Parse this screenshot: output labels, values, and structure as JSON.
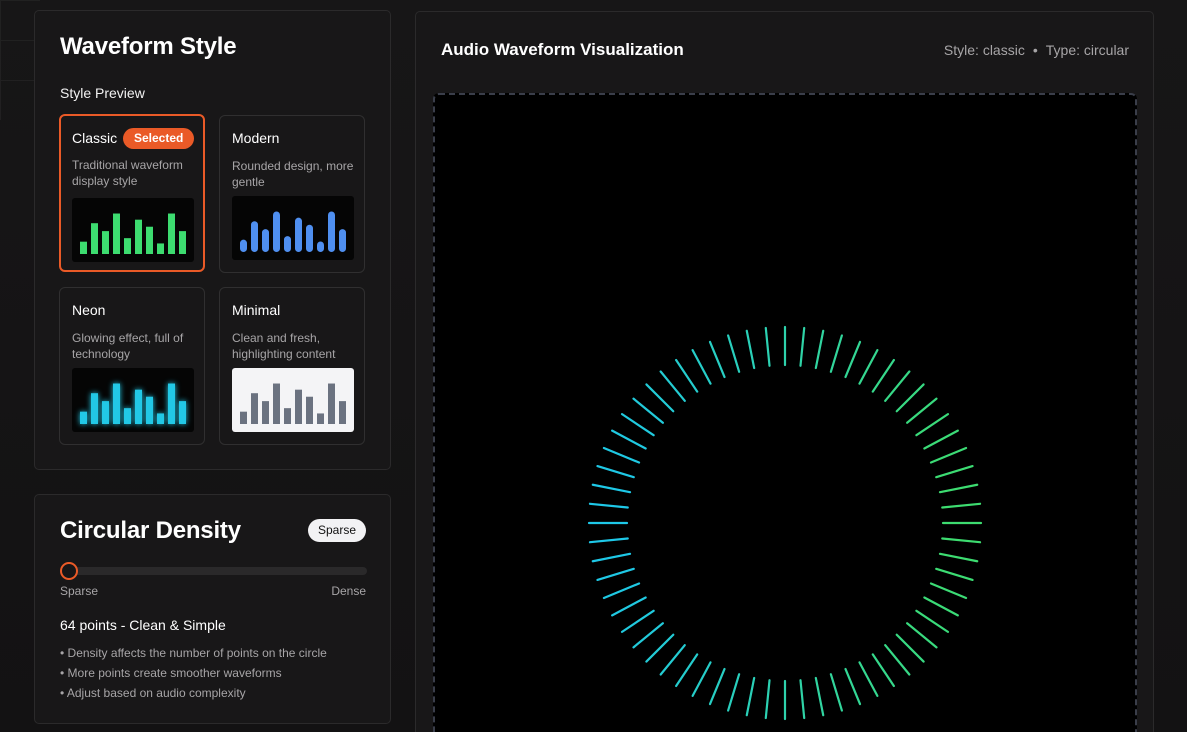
{
  "style_panel": {
    "title": "Waveform Style",
    "subhead": "Style Preview",
    "selected_badge": "Selected",
    "options": [
      {
        "name": "Classic",
        "desc": "Traditional waveform display style",
        "selected": true,
        "bar_color": "#3ddc70",
        "bg": "#050505"
      },
      {
        "name": "Modern",
        "desc": "Rounded design, more gentle",
        "selected": false,
        "bar_color": "#4f8ff0",
        "bg": "#050505"
      },
      {
        "name": "Neon",
        "desc": "Glowing effect, full of technology",
        "selected": false,
        "bar_color": "#22c8e6",
        "bg": "#050505"
      },
      {
        "name": "Minimal",
        "desc": "Clean and fresh, highlighting content",
        "selected": false,
        "bar_color": "#6b7280",
        "bg": "#f4f4f6"
      }
    ],
    "preview_levels": [
      0.28,
      0.7,
      0.52,
      0.92,
      0.36,
      0.78,
      0.62,
      0.24,
      0.92,
      0.52
    ]
  },
  "density_panel": {
    "title": "Circular Density",
    "badge": "Sparse",
    "slider_value": 0,
    "min_label": "Sparse",
    "max_label": "Dense",
    "summary": "64 points - Clean & Simple",
    "notes": [
      "Density affects the number of points on the circle",
      "More points create smoother waveforms",
      "Adjust based on audio complexity"
    ]
  },
  "viz_panel": {
    "title": "Audio Waveform Visualization",
    "style_label": "Style: classic",
    "separator": "•",
    "type_label": "Type: circular",
    "points": 64,
    "colors": {
      "start": "#3ddc70",
      "end": "#1ec8e8",
      "accent": "#ea5a27"
    }
  }
}
